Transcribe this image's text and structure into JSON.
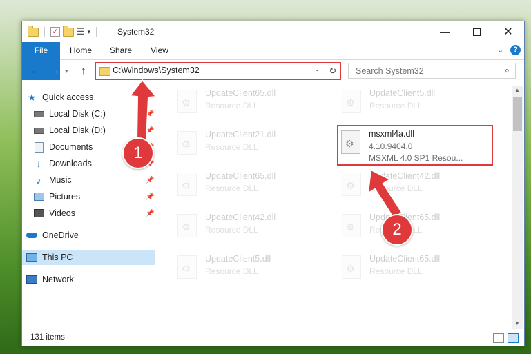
{
  "window": {
    "title": "System32",
    "minimize_icon": "minimize-icon",
    "maximize_icon": "maximize-icon",
    "close_icon": "close-icon"
  },
  "ribbon": {
    "tabs": [
      "File",
      "Home",
      "Share",
      "View"
    ],
    "accent": "#1979ca"
  },
  "address": {
    "path": "C:\\Windows\\System32"
  },
  "search": {
    "placeholder": "Search System32"
  },
  "sidebar": {
    "items": [
      {
        "label": "Quick access",
        "icon": "star-icon",
        "pinned": false
      },
      {
        "label": "Local Disk (C:)",
        "icon": "drive-icon",
        "pinned": true
      },
      {
        "label": "Local Disk (D:)",
        "icon": "drive-icon",
        "pinned": true
      },
      {
        "label": "Documents",
        "icon": "documents-icon",
        "pinned": true
      },
      {
        "label": "Downloads",
        "icon": "download-icon",
        "pinned": true
      },
      {
        "label": "Music",
        "icon": "music-icon",
        "pinned": true
      },
      {
        "label": "Pictures",
        "icon": "pictures-icon",
        "pinned": true
      },
      {
        "label": "Videos",
        "icon": "videos-icon",
        "pinned": true
      },
      {
        "label": "OneDrive",
        "icon": "cloud-icon",
        "pinned": false
      },
      {
        "label": "This PC",
        "icon": "computer-icon",
        "pinned": false,
        "selected": true
      },
      {
        "label": "Network",
        "icon": "network-icon",
        "pinned": false
      }
    ]
  },
  "files": [
    {
      "name": "UpdateClient65.dll",
      "type": "Resource DLL"
    },
    {
      "name": "UpdateClient5.dll",
      "type": "Resource DLL"
    },
    {
      "name": "UpdateClient21.dll",
      "type": "Resource DLL"
    },
    {
      "name": "msxml4a.dll",
      "version": "4.10.9404.0",
      "description": "MSXML 4.0 SP1 Resou...",
      "highlighted": true
    },
    {
      "name": "UpdateClient65.dll",
      "type": "Resource DLL"
    },
    {
      "name": "UpdateClient42.dll",
      "type": "Resource DLL"
    },
    {
      "name": "UpdateClient42.dll",
      "type": "Resource DLL"
    },
    {
      "name": "UpdateClient65.dll",
      "type": "Resource DLL"
    },
    {
      "name": "UpdateClient5.dll",
      "type": "Resource DLL"
    },
    {
      "name": "UpdateClient65.dll",
      "type": "Resource DLL"
    }
  ],
  "status": {
    "item_count": "131 items"
  },
  "annotations": {
    "step1": "1",
    "step2": "2",
    "color": "#e0393b"
  }
}
